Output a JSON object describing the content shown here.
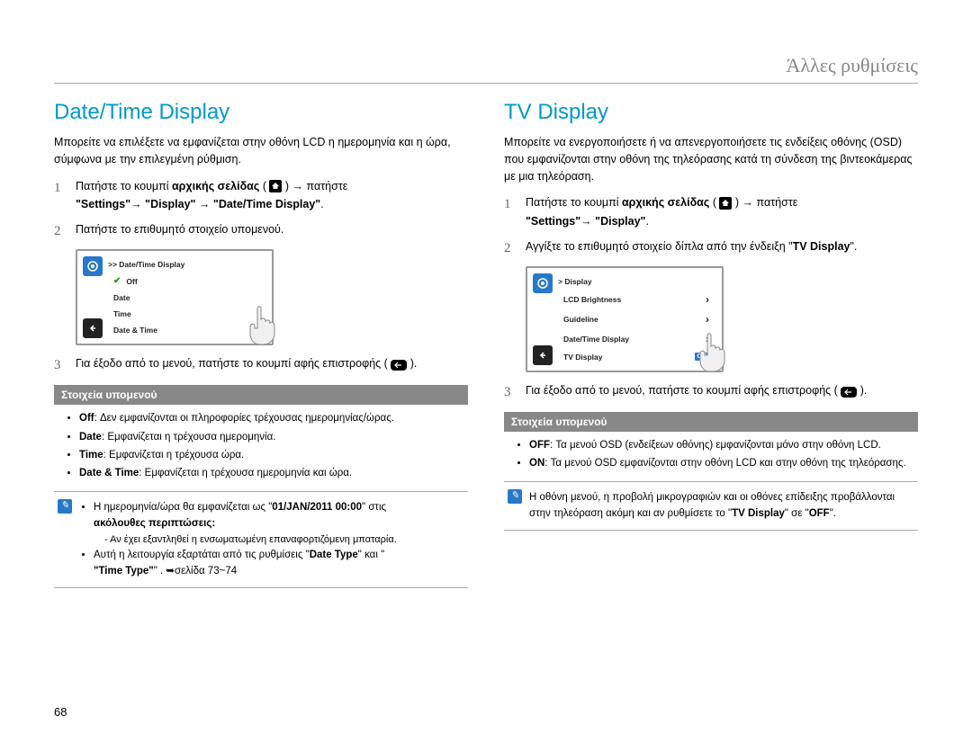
{
  "header": "Άλλες ρυθμίσεις",
  "pageNumber": "68",
  "left": {
    "title": "Date/Time Display",
    "intro": "Μπορείτε να επιλέξετε να εμφανίζεται στην οθόνη LCD η ημερομηνία και η ώρα, σύμφωνα με την επιλεγμένη ρύθμιση.",
    "step1_a": "Πατήστε το κουμπί ",
    "step1_b": "αρχικής σελίδας",
    "step1_c": " ( ",
    "step1_d": " ) → πατήστε ",
    "step1_e": "\"Settings\"→ \"Display\" → \"Date/Time Display\"",
    "step1_f": ".",
    "step2": "Πατήστε το επιθυμητό στοιχείο υπομενού.",
    "step3": "Για έξοδο από το μενού, πατήστε το κουμπί αφής επιστροφής ( ",
    "step3_end": " ).",
    "menu": {
      "title": ">> Date/Time Display",
      "items": [
        "Off",
        "Date",
        "Time",
        "Date & Time"
      ]
    },
    "subTitle": "Στοιχεία υπομενού",
    "bullets": [
      {
        "b": "Off",
        "t": ": Δεν εμφανίζονται οι πληροφορίες τρέχουσας ημερομηνίας/ώρας."
      },
      {
        "b": "Date",
        "t": ": Εμφανίζεται η τρέχουσα ημερομηνία."
      },
      {
        "b": "Time",
        "t": ": Εμφανίζεται η τρέχουσα ώρα."
      },
      {
        "b": "Date & Time",
        "t": ": Εμφανίζεται η τρέχουσα ημερομηνία και ώρα."
      }
    ],
    "note_a": "Η ημερομηνία/ώρα θα εμφανίζεται ως \"",
    "note_b": "01/JAN/2011 00:00",
    "note_c": "\" στις ",
    "note_d": "ακόλουθες περιπτώσεις:",
    "note_sub1": "- Αν έχει εξαντληθεί η ενσωματωμένη επαναφορτιζόμενη μπαταρία.",
    "note_sub2_a": "Αυτή η λειτουργία εξαρτάται από τις ρυθμίσεις \"",
    "note_sub2_b": "Date Type",
    "note_sub2_c": "\" και \"",
    "note_sub2_d": "Time Type",
    "note_sub2_e": "\" . ➥σελίδα 73~74"
  },
  "right": {
    "title": "TV Display",
    "intro": "Μπορείτε να ενεργοποιήσετε ή να απενεργοποιήσετε τις ενδείξεις οθόνης (OSD) που εμφανίζονται στην οθόνη της τηλεόρασης κατά τη σύνδεση της βιντεοκάμερας με μια τηλεόραση.",
    "step1_a": "Πατήστε το κουμπί ",
    "step1_b": "αρχικής σελίδας",
    "step1_c": " ( ",
    "step1_d": " ) → πατήστε ",
    "step1_e": "\"Settings\"→ \"Display\"",
    "step1_f": ".",
    "step2_a": "Αγγίξτε το επιθυμητό στοιχείο δίπλα από την ένδειξη  \"",
    "step2_b": "TV Display",
    "step2_c": "\".",
    "step3": "Για έξοδο από το μενού, πατήστε το κουμπί αφής επιστροφής ( ",
    "step3_end": " ).",
    "menu": {
      "title": "> Display",
      "items": [
        "LCD Brightness",
        "Guideline",
        "Date/Time Display",
        "TV Display"
      ],
      "on": "ON"
    },
    "subTitle": "Στοιχεία υπομενού",
    "bullets": [
      {
        "b": "OFF",
        "t": ": Τα μενού OSD (ενδείξεων οθόνης) εμφανίζονται μόνο στην οθόνη LCD."
      },
      {
        "b": "ON",
        "t": ": Τα μενού OSD εμφανίζονται στην οθόνη LCD και στην οθόνη της τηλεόρασης."
      }
    ],
    "note_a": "Η οθόνη μενού, η προβολή μικρογραφιών και οι οθόνες επίδειξης προβάλλονται στην τηλεόραση ακόμη και αν ρυθμίσετε το \"",
    "note_b": "TV Display",
    "note_c": "\" σε \"",
    "note_d": "OFF",
    "note_e": "\"."
  }
}
